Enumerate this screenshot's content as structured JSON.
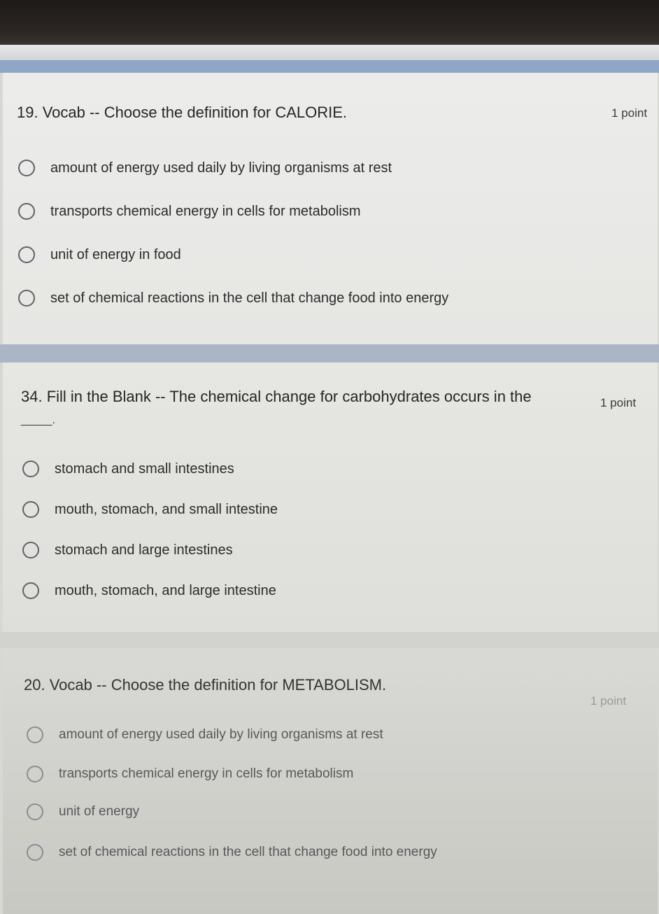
{
  "questions": [
    {
      "title": "19. Vocab -- Choose the definition for CALORIE.",
      "points": "1 point",
      "blank": "",
      "options": [
        "amount of energy used daily by living organisms at rest",
        "transports chemical energy in cells for metabolism",
        "unit of energy in food",
        "set of chemical reactions in the cell that change food into energy"
      ]
    },
    {
      "title": "34. Fill in the Blank -- The chemical change for carbohydrates occurs in the",
      "points": "1 point",
      "blank": "_____.",
      "options": [
        "stomach and small intestines",
        "mouth, stomach, and small intestine",
        "stomach and large intestines",
        "mouth, stomach, and large intestine"
      ]
    },
    {
      "title": "20. Vocab -- Choose the definition for METABOLISM.",
      "points": "1 point",
      "blank": "",
      "options": [
        "amount of energy used daily by living organisms at rest",
        "transports chemical energy in cells for metabolism",
        "unit of energy",
        "set of chemical reactions in the cell that change food into energy"
      ]
    }
  ],
  "colors": {
    "accent_strip": "#8fa6c6",
    "radio_border": "#5f6368",
    "card_background": "#eaeae7"
  }
}
